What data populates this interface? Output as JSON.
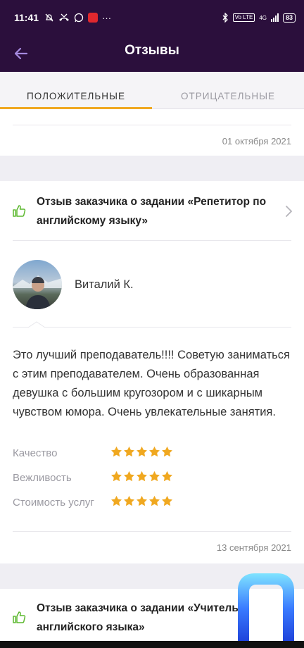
{
  "status_bar": {
    "time": "11:41",
    "more": "···",
    "network": "Vo LTE",
    "signal": "4G",
    "battery": "83"
  },
  "header": {
    "title": "Отзывы"
  },
  "tabs": [
    {
      "label": "ПОЛОЖИТЕЛЬНЫЕ",
      "active": true
    },
    {
      "label": "ОТРИЦАТЕЛЬНЫЕ",
      "active": false
    }
  ],
  "reviews": [
    {
      "date": "01 октября 2021"
    },
    {
      "title": "Отзыв заказчика о задании «Репетитор по английскому языку»",
      "reviewer": "Виталий К.",
      "text": "Это лучший преподаватель!!!! Советую заниматься с этим преподавателем. Очень образованная девушка с большим кругозором и с шикарным чувством юмора. Очень увлекательные занятия.",
      "ratings": [
        {
          "label": "Качество",
          "stars": 5
        },
        {
          "label": "Вежливость",
          "stars": 5
        },
        {
          "label": "Стоимость услуг",
          "stars": 5
        }
      ],
      "date": "13 сентября 2021"
    },
    {
      "title": "Отзыв заказчика о задании «Учитель английского языка»"
    }
  ],
  "colors": {
    "header_bg": "#2b0f3c",
    "accent": "#f0a820",
    "thumb_green": "#5cb82e",
    "back_arrow": "#a68ae0"
  }
}
